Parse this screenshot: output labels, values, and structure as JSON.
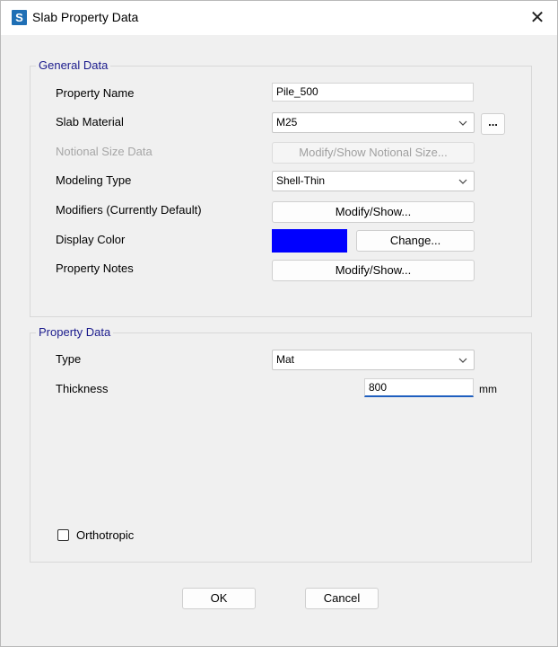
{
  "window": {
    "title": "Slab Property Data",
    "app_icon_letter": "S",
    "close_glyph": "✕"
  },
  "general": {
    "title": "General Data",
    "property_name_label": "Property Name",
    "property_name_value": "Pile_500",
    "slab_material_label": "Slab Material",
    "slab_material_value": "M25",
    "slab_material_more": "...",
    "notional_label": "Notional Size Data",
    "notional_button": "Modify/Show Notional Size...",
    "modeling_type_label": "Modeling Type",
    "modeling_type_value": "Shell-Thin",
    "modifiers_label": "Modifiers (Currently Default)",
    "modifiers_button": "Modify/Show...",
    "display_color_label": "Display Color",
    "display_color_value": "#0000ff",
    "change_button": "Change...",
    "property_notes_label": "Property Notes",
    "property_notes_button": "Modify/Show..."
  },
  "property": {
    "title": "Property Data",
    "type_label": "Type",
    "type_value": "Mat",
    "thickness_label": "Thickness",
    "thickness_value": "800",
    "thickness_unit": "mm",
    "orthotropic_label": "Orthotropic"
  },
  "footer": {
    "ok": "OK",
    "cancel": "Cancel"
  }
}
